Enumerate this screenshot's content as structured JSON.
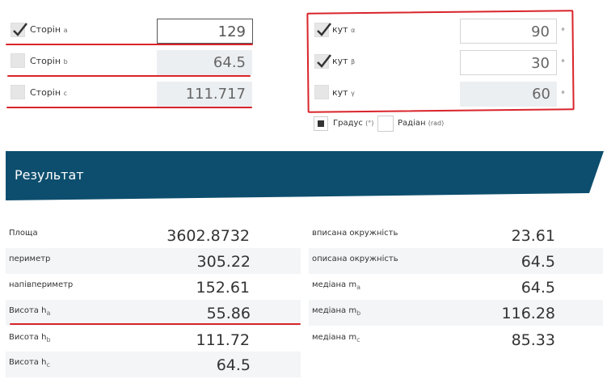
{
  "sides": [
    {
      "label": "Сторін",
      "sub": "a",
      "value": "129",
      "checked": true,
      "state": "active"
    },
    {
      "label": "Сторін",
      "sub": "b",
      "value": "64.5",
      "checked": false,
      "state": "ro"
    },
    {
      "label": "Сторін",
      "sub": "c",
      "value": "111.717",
      "checked": false,
      "state": "ro"
    }
  ],
  "angles": [
    {
      "label": "кут",
      "sub": "α",
      "value": "90",
      "unit": "°",
      "checked": true,
      "state": "edit"
    },
    {
      "label": "кут",
      "sub": "β",
      "value": "30",
      "unit": "°",
      "checked": true,
      "state": "edit"
    },
    {
      "label": "кут",
      "sub": "γ",
      "value": "60",
      "unit": "°",
      "checked": false,
      "state": "ro"
    }
  ],
  "units": {
    "degree_label": "Градус",
    "degree_abbr": "(°)",
    "radian_label": "Радіан",
    "radian_abbr": "(rad)",
    "selected": "degree"
  },
  "result_title": "Результат",
  "results_left": [
    {
      "label": "Площа",
      "sub": "",
      "value": "3602.8732"
    },
    {
      "label": "периметр",
      "sub": "",
      "value": "305.22"
    },
    {
      "label": "напівпериметр",
      "sub": "",
      "value": "152.61"
    },
    {
      "label": "Висота h",
      "sub": "a",
      "value": "55.86"
    },
    {
      "label": "Висота h",
      "sub": "b",
      "value": "111.72"
    },
    {
      "label": "Висота h",
      "sub": "c",
      "value": "64.5"
    }
  ],
  "results_right": [
    {
      "label": "вписана окружність",
      "sub": "",
      "value": "23.61"
    },
    {
      "label": "описана окружність",
      "sub": "",
      "value": "64.5"
    },
    {
      "label": "медіана m",
      "sub": "a",
      "value": "64.5"
    },
    {
      "label": "медіана m",
      "sub": "b",
      "value": "116.28"
    },
    {
      "label": "медіана m",
      "sub": "c",
      "value": "85.33"
    }
  ],
  "colors": {
    "banner": "#0d4e6e",
    "annotation": "#d9242a",
    "field_readonly": "#eceff2"
  }
}
